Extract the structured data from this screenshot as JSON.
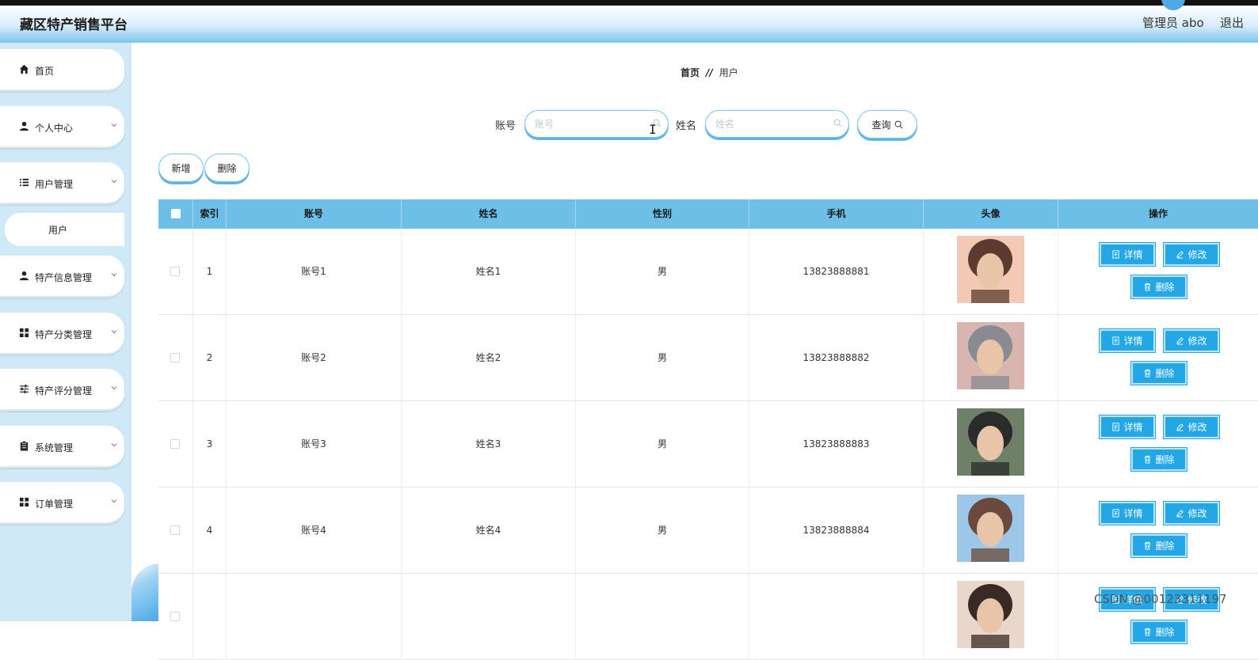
{
  "app": {
    "title": "藏区特产销售平台",
    "admin_text": "管理员 abo",
    "logout_label": "退出"
  },
  "sidebar": {
    "items": [
      {
        "label": "首页",
        "icon": "home-icon"
      },
      {
        "label": "个人中心",
        "icon": "user-icon"
      },
      {
        "label": "用户管理",
        "icon": "list-icon"
      },
      {
        "label": "特产信息管理",
        "icon": "user-icon"
      },
      {
        "label": "特产分类管理",
        "icon": "grid-icon"
      },
      {
        "label": "特产评分管理",
        "icon": "sliders-icon"
      },
      {
        "label": "系统管理",
        "icon": "clipboard-icon"
      },
      {
        "label": "订单管理",
        "icon": "grid-icon"
      }
    ],
    "sub_item": {
      "label": "用户"
    }
  },
  "breadcrumb": {
    "home": "首页",
    "separator": "//",
    "current": "用户"
  },
  "search": {
    "account_label": "账号",
    "account_placeholder": "账号",
    "account_value": "",
    "name_label": "姓名",
    "name_placeholder": "姓名",
    "name_value": "",
    "query_label": "查询"
  },
  "actions": {
    "add_label": "新增",
    "delete_label": "删除"
  },
  "table": {
    "headers": {
      "index": "索引",
      "account": "账号",
      "name": "姓名",
      "gender": "性别",
      "phone": "手机",
      "avatar": "头像",
      "ops": "操作"
    },
    "rows": [
      {
        "index": "1",
        "account": "账号1",
        "name": "姓名1",
        "gender": "男",
        "phone": "13823888881"
      },
      {
        "index": "2",
        "account": "账号2",
        "name": "姓名2",
        "gender": "男",
        "phone": "13823888882"
      },
      {
        "index": "3",
        "account": "账号3",
        "name": "姓名3",
        "gender": "男",
        "phone": "13823888883"
      },
      {
        "index": "4",
        "account": "账号4",
        "name": "姓名4",
        "gender": "男",
        "phone": "13823888884"
      }
    ],
    "row_actions": {
      "detail": "详情",
      "edit": "修改",
      "delete": "删除"
    }
  },
  "watermark": "CSDN @00123311197",
  "colors": {
    "accent": "#23a7e6",
    "header_row": "#6dbfe7",
    "sidebar_bg": "#cfe9f7"
  }
}
